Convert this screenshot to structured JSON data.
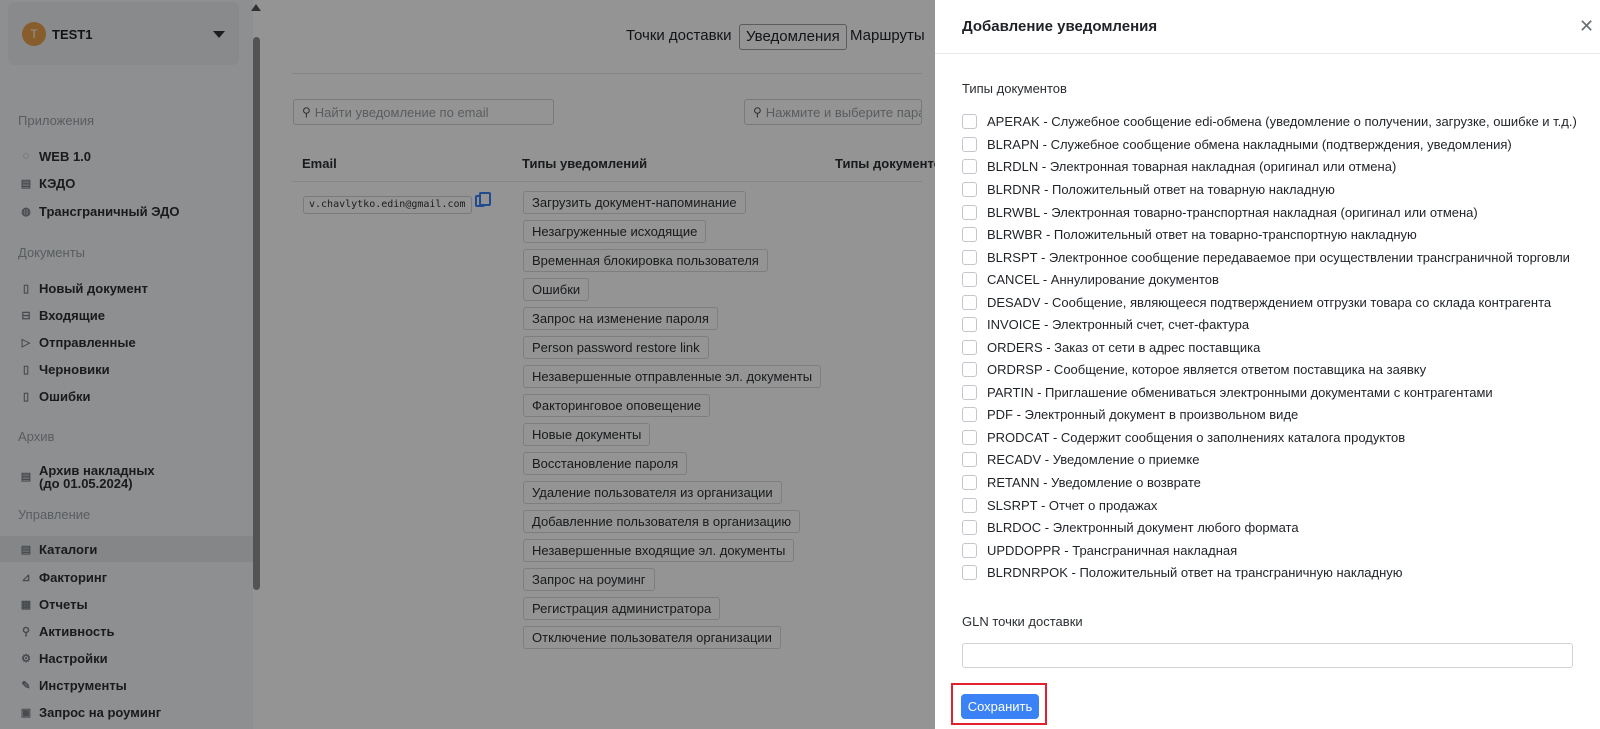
{
  "account": {
    "avatar_letter": "T",
    "name": "TEST1",
    "caret_icon": "chevron-down-icon"
  },
  "sidebar": {
    "sections": [
      {
        "title": "Приложения",
        "items": [
          {
            "label": "WEB 1.0",
            "icon": "refresh-icon"
          },
          {
            "label": "КЭДО",
            "icon": "document-icon"
          },
          {
            "label": "Трансграничный ЭДО",
            "icon": "globe-icon"
          }
        ]
      },
      {
        "title": "Документы",
        "items": [
          {
            "label": "Новый документ",
            "icon": "file-icon"
          },
          {
            "label": "Входящие",
            "icon": "inbox-icon"
          },
          {
            "label": "Отправленные",
            "icon": "send-icon"
          },
          {
            "label": "Черновики",
            "icon": "file-icon"
          },
          {
            "label": "Ошибки",
            "icon": "file-icon"
          }
        ]
      },
      {
        "title": "Архив",
        "items": [
          {
            "label": "Архив накладных\n(до 01.05.2024)",
            "icon": "archive-icon"
          }
        ]
      },
      {
        "title": "Управление",
        "items": [
          {
            "label": "Каталоги",
            "icon": "catalog-icon",
            "active": true
          },
          {
            "label": "Факторинг",
            "icon": "chart-icon"
          },
          {
            "label": "Отчеты",
            "icon": "report-icon"
          },
          {
            "label": "Активность",
            "icon": "search-icon"
          },
          {
            "label": "Настройки",
            "icon": "gear-icon"
          },
          {
            "label": "Инструменты",
            "icon": "wrench-icon"
          },
          {
            "label": "Запрос на роуминг",
            "icon": "roaming-icon"
          }
        ]
      }
    ]
  },
  "main": {
    "tabs": [
      {
        "label": "Точки доставки",
        "active": false
      },
      {
        "label": "Уведомления",
        "active": true
      },
      {
        "label": "Маршруты",
        "active": false
      }
    ],
    "search_email_placeholder": "Найти уведомление по email",
    "search_type_placeholder": "Нажмите и выберите параметр",
    "columns": [
      "Email",
      "Типы уведомлений",
      "Типы документов"
    ],
    "row": {
      "email": "v.chavlytko.edin@gmail.com",
      "notification_types": [
        "Загрузить документ-напоминание",
        "Незагруженные исходящие",
        "Временная блокировка пользователя",
        "Ошибки",
        "Запрос на изменение пароля",
        "Person password restore link",
        "Незавершенные отправленные эл. документы",
        "Факторинговое оповещение",
        "Новые документы",
        "Восстановление пароля",
        "Удаление пользователя из организации",
        "Добавленние пользователя в организацию",
        "Незавершенные входящие эл. документы",
        "Запрос на роуминг",
        "Регистрация администратора",
        "Отключение пользователя организации"
      ]
    }
  },
  "drawer": {
    "title": "Добавление уведомления",
    "close_icon": "close-icon",
    "doc_types_label": "Типы документов",
    "doc_types": [
      "APERAK - Служебное сообщение edi-обмена (уведомление о получении, загрузке, ошибке и т.д.)",
      "BLRAPN - Служебное сообщение обмена накладными (подтверждения, уведомления)",
      "BLRDLN - Электронная товарная накладная (оригинал или отмена)",
      "BLRDNR - Положительный ответ на товарную накладную",
      "BLRWBL - Электронная товарно-транспортная накладная (оригинал или отмена)",
      "BLRWBR - Положительный ответ на товарно-транспортную накладную",
      "BLRSPT - Электронное сообщение передаваемое при осуществлении трансграничной торговли",
      "CANCEL - Аннулирование документов",
      "DESADV - Сообщение, являющееся подтверждением отгрузки товара со склада контрагента",
      "INVOICE - Электронный счет, счет-фактура",
      "ORDERS - Заказ от сети в адрес поставщика",
      "ORDRSP - Сообщение, которое является ответом поставщика на заявку",
      "PARTIN - Приглашение обмениваться электронными документами с контрагентами",
      "PDF - Электронный документ в произвольном виде",
      "PRODCAT - Содержит сообщения о заполнениях каталога продуктов",
      "RECADV - Уведомление о приемке",
      "RETANN - Уведомление о возврате",
      "SLSRPT - Отчет о продажах",
      "BLRDOC - Электронный документ любого формата",
      "UPDDOPPR - Трансграничная накладная",
      "BLRDNRPOK - Положительный ответ на трансграничную накладную"
    ],
    "gln_label": "GLN точки доставки",
    "gln_value": "",
    "save_label": "Сохранить"
  },
  "colors": {
    "accent": "#3b82f6",
    "highlight": "#e0212e",
    "avatar": "#e8a24a"
  }
}
